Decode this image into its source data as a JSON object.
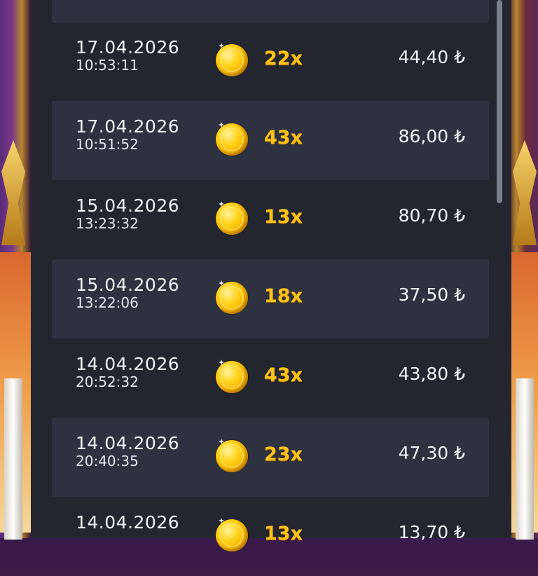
{
  "history": {
    "rows": [
      {
        "date": "17.04.2026",
        "time": "10:53:11",
        "multiplier": "22x",
        "amount": "44,40 ₺"
      },
      {
        "date": "17.04.2026",
        "time": "10:51:52",
        "multiplier": "43x",
        "amount": "86,00 ₺"
      },
      {
        "date": "15.04.2026",
        "time": "13:23:32",
        "multiplier": "13x",
        "amount": "80,70 ₺"
      },
      {
        "date": "15.04.2026",
        "time": "13:22:06",
        "multiplier": "18x",
        "amount": "37,50 ₺"
      },
      {
        "date": "14.04.2026",
        "time": "20:52:32",
        "multiplier": "43x",
        "amount": "43,80 ₺"
      },
      {
        "date": "14.04.2026",
        "time": "20:40:35",
        "multiplier": "23x",
        "amount": "47,30 ₺"
      },
      {
        "date": "14.04.2026",
        "time": "",
        "multiplier": "13x",
        "amount": "13,70 ₺"
      }
    ]
  },
  "icons": {
    "coin": "gold-coin-icon"
  },
  "colors": {
    "panel": "#23262f",
    "row_alt": "#2e3240",
    "multiplier": "#ffc21a"
  }
}
